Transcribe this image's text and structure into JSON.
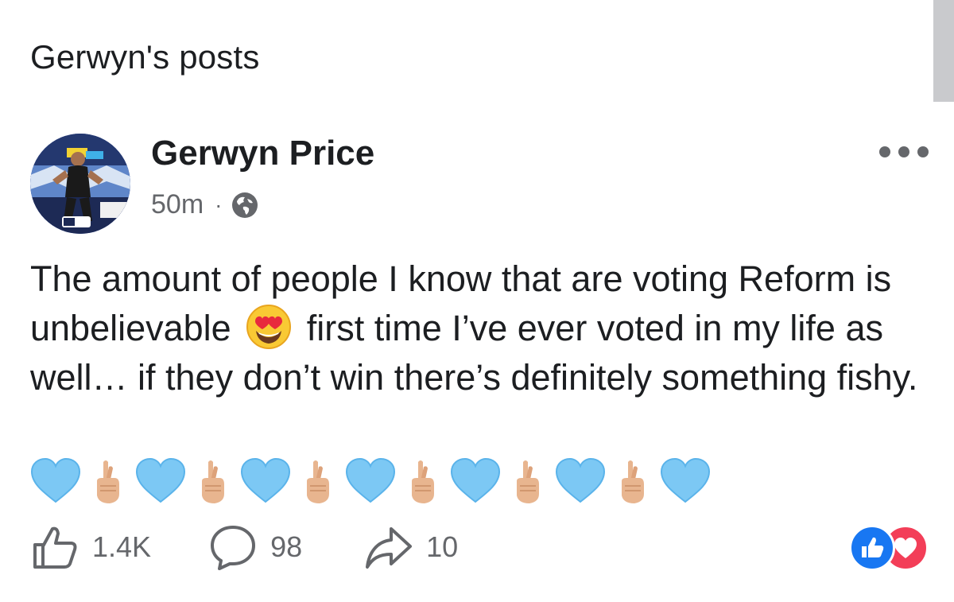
{
  "header": {
    "title": "Gerwyn's posts"
  },
  "post": {
    "author": "Gerwyn Price",
    "time": "50m",
    "separator": "·",
    "privacy_icon": "globe-icon",
    "more_icon": "more-horizontal-icon",
    "body_part1": "The amount of people I know that are voting Reform is unbelievable",
    "inline_emoji": "heart-eyes-emoji",
    "body_part2": "first time I’ve ever voted in my life as well… if they don’t win there’s definitely something fishy.",
    "emoji_sequence": [
      "light-blue-heart",
      "crossed-fingers",
      "light-blue-heart",
      "crossed-fingers",
      "light-blue-heart",
      "crossed-fingers",
      "light-blue-heart",
      "crossed-fingers",
      "light-blue-heart",
      "crossed-fingers",
      "light-blue-heart"
    ]
  },
  "actions": {
    "likes": "1.4K",
    "comments": "98",
    "shares": "10"
  },
  "reactions": [
    "like",
    "love"
  ],
  "colors": {
    "text": "#1c1e21",
    "secondary": "#65676b",
    "like_blue": "#1877f2",
    "love_red": "#f33e58",
    "light_blue_heart": "#7cc8f4",
    "skin_tone": "#e8b58f"
  }
}
